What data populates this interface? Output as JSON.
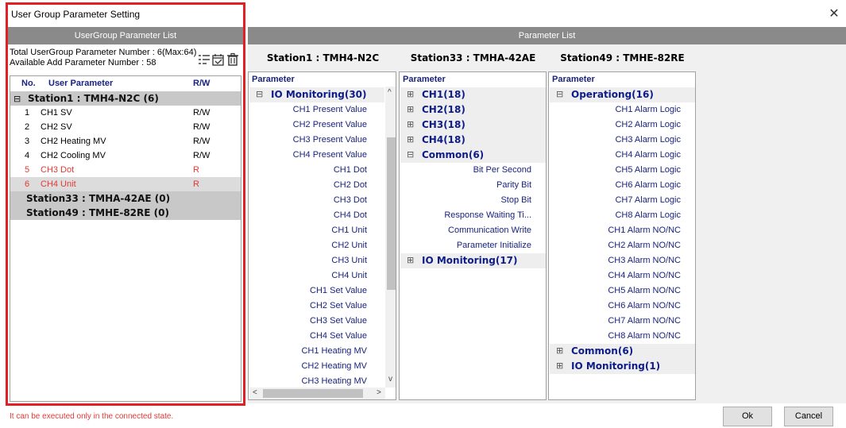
{
  "window": {
    "title": "User Group Parameter Setting",
    "close_symbol": "✕"
  },
  "left": {
    "header": "UserGroup Parameter List",
    "total_text": "Total UserGroup Parameter Number : 6(Max:64)",
    "available_text": "Available Add Parameter Number : 58",
    "toolbar_icons": [
      "list-edit-icon",
      "calendar-check-icon",
      "trash-icon"
    ],
    "columns": {
      "no": "No.",
      "param": "User Parameter",
      "rw": "R/W"
    },
    "groups": [
      {
        "label": "Station1 : TMH4-N2C   (6)",
        "expander": "⊟",
        "rows": [
          {
            "no": "1",
            "param": "CH1 SV",
            "rw": "R/W",
            "red": false
          },
          {
            "no": "2",
            "param": "CH2 SV",
            "rw": "R/W",
            "red": false
          },
          {
            "no": "3",
            "param": "CH2 Heating MV",
            "rw": "R/W",
            "red": false
          },
          {
            "no": "4",
            "param": "CH2 Cooling MV",
            "rw": "R/W",
            "red": false
          },
          {
            "no": "5",
            "param": "CH3 Dot",
            "rw": "R",
            "red": true
          },
          {
            "no": "6",
            "param": "CH4 Unit",
            "rw": "R",
            "red": true
          }
        ]
      },
      {
        "label": "Station33 : TMHA-42AE  (0)",
        "expander": "",
        "rows": []
      },
      {
        "label": "Station49 : TMHE-82RE  (0)",
        "expander": "",
        "rows": []
      }
    ]
  },
  "right": {
    "header": "Parameter List",
    "param_head": "Parameter",
    "stations": [
      {
        "title": "Station1 : TMH4-N2C",
        "groups": [
          {
            "label": "IO Monitoring(30)",
            "expander": "⊟",
            "items": [
              "CH1 Present Value",
              "CH2 Present Value",
              "CH3 Present Value",
              "CH4 Present Value",
              "CH1 Dot",
              "CH2 Dot",
              "CH3 Dot",
              "CH4 Dot",
              "CH1 Unit",
              "CH2 Unit",
              "CH3 Unit",
              "CH4 Unit",
              "CH1 Set Value",
              "CH2 Set Value",
              "CH3 Set Value",
              "CH4 Set Value",
              "CH1 Heating MV",
              "CH2 Heating MV",
              "CH3 Heating MV"
            ]
          }
        ]
      },
      {
        "title": "Station33 : TMHA-42AE",
        "groups": [
          {
            "label": "CH1(18)",
            "expander": "⊞",
            "items": []
          },
          {
            "label": "CH2(18)",
            "expander": "⊞",
            "items": []
          },
          {
            "label": "CH3(18)",
            "expander": "⊞",
            "items": []
          },
          {
            "label": "CH4(18)",
            "expander": "⊞",
            "items": []
          },
          {
            "label": "Common(6)",
            "expander": "⊟",
            "items": [
              "Bit Per Second",
              "Parity Bit",
              "Stop Bit",
              "Response Waiting Ti...",
              "Communication Write",
              "Parameter Initialize"
            ]
          },
          {
            "label": "IO Monitoring(17)",
            "expander": "⊞",
            "items": []
          }
        ]
      },
      {
        "title": "Station49 : TMHE-82RE",
        "groups": [
          {
            "label": "Operationg(16)",
            "expander": "⊟",
            "items": [
              "CH1 Alarm Logic",
              "CH2 Alarm Logic",
              "CH3 Alarm Logic",
              "CH4 Alarm Logic",
              "CH5 Alarm Logic",
              "CH6 Alarm Logic",
              "CH7 Alarm Logic",
              "CH8 Alarm Logic",
              "CH1 Alarm NO/NC",
              "CH2 Alarm NO/NC",
              "CH3 Alarm NO/NC",
              "CH4 Alarm NO/NC",
              "CH5 Alarm NO/NC",
              "CH6 Alarm NO/NC",
              "CH7 Alarm NO/NC",
              "CH8 Alarm NO/NC"
            ]
          },
          {
            "label": "Common(6)",
            "expander": "⊞",
            "items": []
          },
          {
            "label": "IO Monitoring(1)",
            "expander": "⊞",
            "items": []
          }
        ]
      }
    ],
    "scroll_arrows": {
      "up": "^",
      "down": "v",
      "left": "<",
      "right": ">"
    }
  },
  "footer": {
    "message": "It can be executed only in the connected state.",
    "ok": "Ok",
    "cancel": "Cancel"
  },
  "colors": {
    "header_gray": "#8a8a8a",
    "highlight_red": "#e31e24",
    "param_blue": "#1a237e",
    "warning_red": "#e53935"
  }
}
